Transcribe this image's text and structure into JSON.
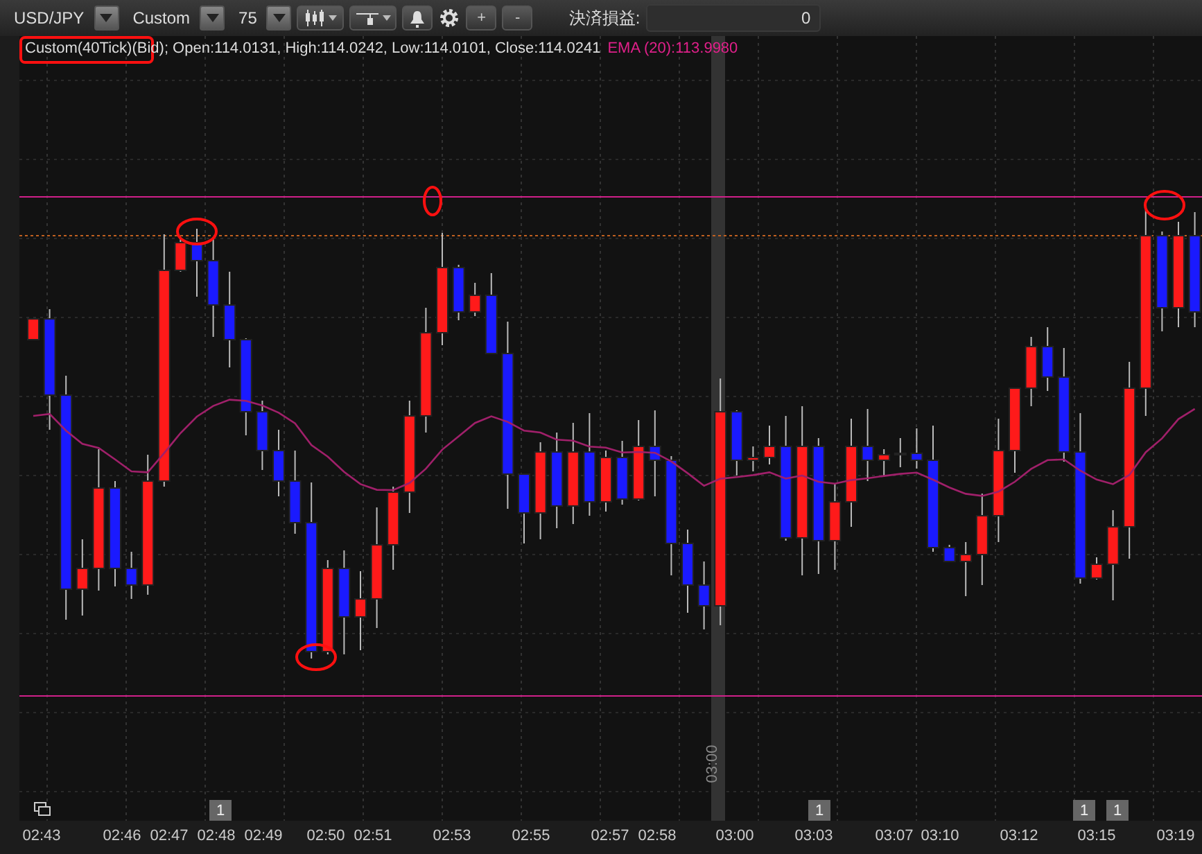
{
  "toolbar": {
    "symbol": "USD/JPY",
    "timeframe": "Custom",
    "count": "75",
    "zoom_in": "+",
    "zoom_out": "-",
    "pnl_label": "決済損益:",
    "pnl_value": "0"
  },
  "chart": {
    "legend": "Custom(40Tick)(Bid); Open:114.0131, High:114.0242, Low:114.0101, Close:114.0241",
    "ema_label": "EMA (20):113.9980",
    "session_label": "03:00",
    "badges": [
      "1",
      "1",
      "1",
      "1"
    ],
    "time_labels": [
      "02:43",
      "02:46",
      "02:47",
      "02:48",
      "02:49",
      "02:50",
      "02:51",
      "02:53",
      "02:55",
      "02:57",
      "02:58",
      "03:00",
      "03:03",
      "03:07",
      "03:10",
      "03:12",
      "03:15",
      "03:19"
    ]
  }
}
